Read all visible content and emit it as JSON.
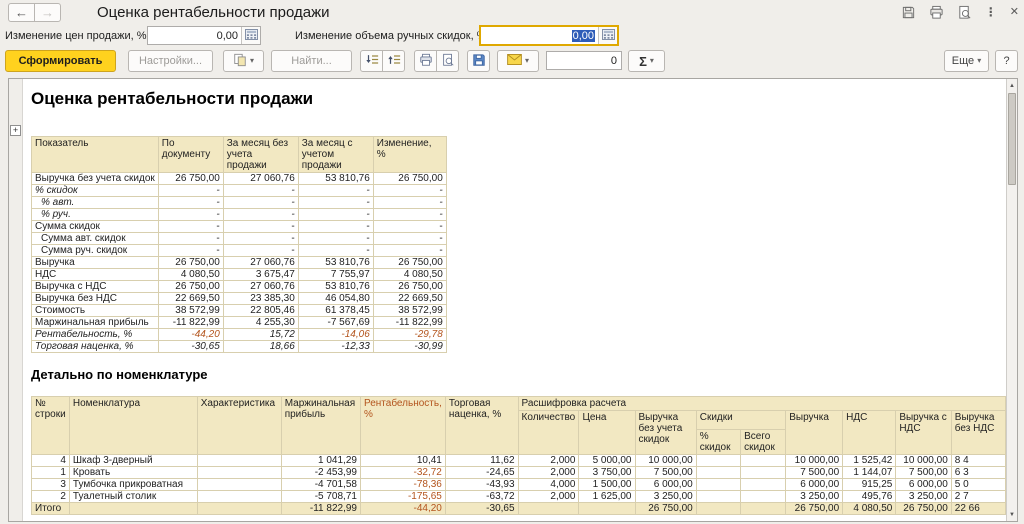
{
  "window": {
    "title": "Оценка рентабельности продажи"
  },
  "icons": {
    "back": "←",
    "forward": "→",
    "kebab": "⋮",
    "close": "✕",
    "caret": "▾",
    "scroll_up": "▲",
    "scroll_down": "▼",
    "expander": "+"
  },
  "params": {
    "price_change_label": "Изменение цен продажи, %:",
    "price_change_value": "0,00",
    "discount_change_label": "Изменение объема ручных скидок, %:",
    "discount_change_value": "0,00"
  },
  "toolbar": {
    "generate": "Сформировать",
    "settings": "Настройки...",
    "find": "Найти...",
    "counter_value": "0",
    "sigma": "Σ",
    "more": "Еще",
    "help": "?"
  },
  "report": {
    "title": "Оценка рентабельности продажи",
    "summary_table": {
      "headers": [
        "Показатель",
        "По документу",
        "За месяц без учета продажи",
        "За месяц с учетом продажи",
        "Изменение, %"
      ],
      "rows": [
        {
          "label": "Выручка без учета скидок",
          "values": [
            "26 750,00",
            "27 060,76",
            "53 810,76",
            "26 750,00"
          ]
        },
        {
          "label": "% скидок",
          "italic": true,
          "values": [
            "-",
            "-",
            "-",
            "-"
          ]
        },
        {
          "label": "% авт.",
          "italic": true,
          "indent": true,
          "values": [
            "-",
            "-",
            "-",
            "-"
          ]
        },
        {
          "label": "% руч.",
          "italic": true,
          "indent": true,
          "values": [
            "-",
            "-",
            "-",
            "-"
          ]
        },
        {
          "label": "Сумма скидок",
          "values": [
            "-",
            "-",
            "-",
            "-"
          ]
        },
        {
          "label": "Сумма авт. скидок",
          "indent": true,
          "values": [
            "-",
            "-",
            "-",
            "-"
          ]
        },
        {
          "label": "Сумма руч. скидок",
          "indent": true,
          "values": [
            "-",
            "-",
            "-",
            "-"
          ]
        },
        {
          "label": "Выручка",
          "values": [
            "26 750,00",
            "27 060,76",
            "53 810,76",
            "26 750,00"
          ]
        },
        {
          "label": "НДС",
          "values": [
            "4 080,50",
            "3 675,47",
            "7 755,97",
            "4 080,50"
          ]
        },
        {
          "label": "Выручка с НДС",
          "values": [
            "26 750,00",
            "27 060,76",
            "53 810,76",
            "26 750,00"
          ]
        },
        {
          "label": "Выручка без НДС",
          "values": [
            "22 669,50",
            "23 385,30",
            "46 054,80",
            "22 669,50"
          ]
        },
        {
          "label": "Стоимость",
          "values": [
            "38 572,99",
            "22 805,46",
            "61 378,45",
            "38 572,99"
          ]
        },
        {
          "label": "Маржинальная прибыль",
          "values": [
            "-11 822,99",
            "4 255,30",
            "-7 567,69",
            "-11 822,99"
          ]
        },
        {
          "label": "Рентабельность, %",
          "italic": true,
          "red_neg": true,
          "values": [
            "-44,20",
            "15,72",
            "-14,06",
            "-29,78"
          ]
        },
        {
          "label": "Торговая наценка, %",
          "italic": true,
          "values": [
            "-30,65",
            "18,66",
            "-12,33",
            "-30,99"
          ]
        }
      ]
    },
    "detail_title": "Детально по номенклатуре",
    "detail_table": {
      "main_headers": [
        "№ строки",
        "Номенклатура",
        "Характеристика",
        "Маржинальная прибыль",
        "Рентабельность, %",
        "Торговая наценка, %"
      ],
      "group_header": "Расшифровка расчета",
      "calc_headers_left": [
        "Количество",
        "Цена",
        "Выручка без учета скидок"
      ],
      "discount_group": "Скидки",
      "sub_headers": [
        "% скидок",
        "Всего скидок"
      ],
      "calc_headers_right": [
        "Выручка",
        "НДС",
        "Выручка с НДС",
        "Выручка\nбез НДС"
      ],
      "rows": [
        [
          "4",
          "Шкаф 3-дверный",
          "",
          "1 041,29",
          "10,41",
          "11,62",
          "2,000",
          "5 000,00",
          "10 000,00",
          "",
          "",
          "10 000,00",
          "1 525,42",
          "10 000,00",
          "8 4"
        ],
        [
          "1",
          "Кровать",
          "",
          "-2 453,99",
          "-32,72",
          "-24,65",
          "2,000",
          "3 750,00",
          "7 500,00",
          "",
          "",
          "7 500,00",
          "1 144,07",
          "7 500,00",
          "6 3"
        ],
        [
          "3",
          "Тумбочка прикроватная",
          "",
          "-4 701,58",
          "-78,36",
          "-43,93",
          "4,000",
          "1 500,00",
          "6 000,00",
          "",
          "",
          "6 000,00",
          "915,25",
          "6 000,00",
          "5 0"
        ],
        [
          "2",
          "Туалетный столик",
          "",
          "-5 708,71",
          "-175,65",
          "-63,72",
          "2,000",
          "1 625,00",
          "3 250,00",
          "",
          "",
          "3 250,00",
          "495,76",
          "3 250,00",
          "2 7"
        ]
      ],
      "total_row": [
        "Итого",
        "",
        "",
        "-11 822,99",
        "-44,20",
        "-30,65",
        "",
        "",
        "26 750,00",
        "",
        "",
        "26 750,00",
        "4 080,50",
        "26 750,00",
        "22 66"
      ]
    }
  },
  "colors": {
    "accent_yellow": "#ffd21e",
    "table_header_bg": "#f2e8c2",
    "grid_border": "#d8cfae",
    "negative_value": "#b3541d",
    "selection": "#2e5cb8",
    "focus_border": "#dfa800"
  }
}
